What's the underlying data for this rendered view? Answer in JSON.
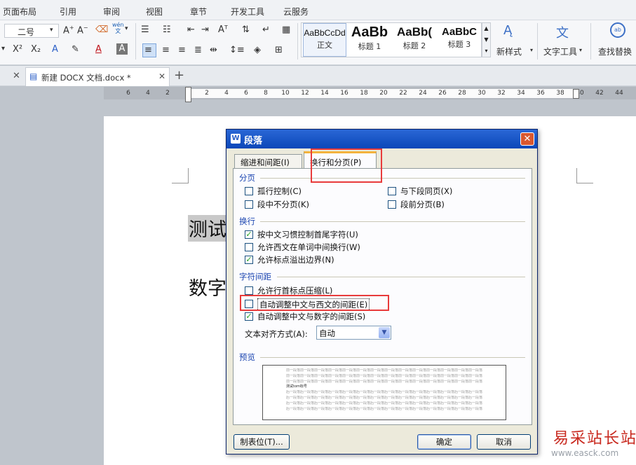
{
  "menu": [
    "页面布局",
    "引用",
    "审阅",
    "视图",
    "章节",
    "开发工具",
    "云服务"
  ],
  "ribbon": {
    "font_size": "二号",
    "wen_label": "wén\n文",
    "styles": [
      {
        "preview": "AaBbCcDd",
        "name": "正文"
      },
      {
        "preview": "AaBb",
        "name": "标题 1"
      },
      {
        "preview": "AaBb(",
        "name": "标题 2"
      },
      {
        "preview": "AaBbC",
        "name": "标题 3"
      }
    ],
    "new_style": "新样式",
    "text_tools": "文字工具",
    "find_replace": "查找替换"
  },
  "tab": {
    "title": "新建 DOCX 文档.docx *"
  },
  "ruler": {
    "left": [
      "6",
      "4",
      "2"
    ],
    "right": [
      "2",
      "4",
      "6",
      "8",
      "10",
      "12",
      "14",
      "16",
      "18",
      "20",
      "22",
      "24",
      "26",
      "28",
      "30",
      "32",
      "34",
      "36",
      "38",
      "40",
      "42",
      "44"
    ]
  },
  "document": {
    "line1": "测试",
    "line2": "数字"
  },
  "dialog": {
    "title": "段落",
    "tabs": [
      "缩进和间距(I)",
      "换行和分页(P)"
    ],
    "sections": {
      "fenye": {
        "title": "分页",
        "options": [
          {
            "label": "孤行控制(C)",
            "checked": false
          },
          {
            "label": "与下段同页(X)",
            "checked": false
          },
          {
            "label": "段中不分页(K)",
            "checked": false
          },
          {
            "label": "段前分页(B)",
            "checked": false
          }
        ]
      },
      "huanhang": {
        "title": "换行",
        "options": [
          {
            "label": "按中文习惯控制首尾字符(U)",
            "checked": true
          },
          {
            "label": "允许西文在单词中间换行(W)",
            "checked": false
          },
          {
            "label": "允许标点溢出边界(N)",
            "checked": true
          }
        ]
      },
      "zifu": {
        "title": "字符间距",
        "options": [
          {
            "label": "允许行首标点压缩(L)",
            "checked": false
          },
          {
            "label": "自动调整中文与西文的间距(E)",
            "checked": false
          },
          {
            "label": "自动调整中文与数字的间距(S)",
            "checked": true
          }
        ]
      }
    },
    "align_label": "文本对齐方式(A):",
    "align_value": "自动",
    "preview_title": "预览",
    "preview_text": {
      "prev": "前一段落前一段落前一段落前一段落前一段落前一段落前一段落前一段落前一段落前一段落前一段落前一段落前一段落前一段落前一段落",
      "cur": "测试tom标号",
      "next": "后一段落后一段落后一段落后一段落后一段落后一段落后一段落后一段落后一段落后一段落后一段落后一段落后一段落后一段落后一段落"
    },
    "tabs_button": "制表位(T)...",
    "ok": "确定",
    "cancel": "取消"
  },
  "watermark": {
    "cn": "易采站长站",
    "url": "www.easck.com"
  },
  "colors": {
    "accent": "#2b5fc7",
    "highlight_red": "#e83b3b",
    "checkmark": "#21a121"
  }
}
